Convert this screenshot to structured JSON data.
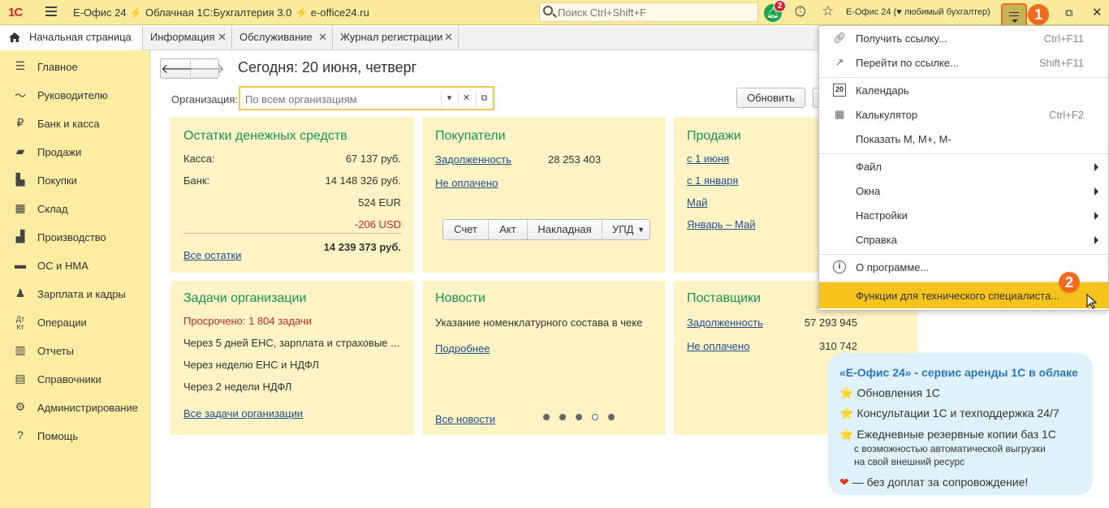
{
  "topbar": {
    "logo": "1С",
    "title": "Е-Офис 24 ⚡ Облачная 1С:Бухгалтерия 3.0 ⚡ e-office24.ru",
    "search_placeholder": "Поиск Ctrl+Shift+F",
    "notifications_count": "2",
    "user": "Е-Офис 24 (♥ любимый бухгалтер)"
  },
  "callouts": {
    "one": "1",
    "two": "2"
  },
  "tabs": [
    "Начальная страница",
    "Информация",
    "Обслуживание",
    "Журнал регистрации"
  ],
  "sidebar": [
    {
      "label": "Главное",
      "icon": "list-icon"
    },
    {
      "label": "Руководителю",
      "icon": "trend-icon"
    },
    {
      "label": "Банк и касса",
      "icon": "coin-icon"
    },
    {
      "label": "Продажи",
      "icon": "bag-icon"
    },
    {
      "label": "Покупки",
      "icon": "cart-icon"
    },
    {
      "label": "Склад",
      "icon": "grid-icon"
    },
    {
      "label": "Производство",
      "icon": "factory-icon"
    },
    {
      "label": "ОС и НМА",
      "icon": "truck-icon"
    },
    {
      "label": "Зарплата и кадры",
      "icon": "person-icon"
    },
    {
      "label": "Операции",
      "icon": "dt-kt-icon"
    },
    {
      "label": "Отчеты",
      "icon": "bars-icon"
    },
    {
      "label": "Справочники",
      "icon": "book-icon"
    },
    {
      "label": "Администрирование",
      "icon": "gear-icon"
    },
    {
      "label": "Помощь",
      "icon": "question-icon"
    }
  ],
  "main": {
    "today": "Сегодня: 20 июня, четверг",
    "org_label": "Организация:",
    "org_placeholder": "По всем организациям",
    "refresh": "Обновить"
  },
  "cash": {
    "title": "Остатки денежных средств",
    "kassa_label": "Касса:",
    "kassa_value": "67 137 руб.",
    "bank_label": "Банк:",
    "bank_value": "14 148 326 руб.",
    "eur": "524 EUR",
    "usd": "-206 USD",
    "total": "14 239 373 руб.",
    "link": "Все остатки"
  },
  "buyers": {
    "title": "Покупатели",
    "debt_link": "Задолженность",
    "debt_value": "28 253 403",
    "unpaid_link": "Не оплачено",
    "buttons": [
      "Счет",
      "Акт",
      "Накладная",
      "УПД"
    ]
  },
  "sales": {
    "title": "Продажи",
    "links": [
      "с 1 июня",
      "с 1 января",
      "Май",
      "Январь – Май"
    ]
  },
  "tasks": {
    "title": "Задачи организации",
    "overdue": "Просрочено: 1 804 задачи",
    "items": [
      "Через 5 дней ЕНС, зарплата и страховые ...",
      "Через неделю ЕНС и НДФЛ",
      "Через 2 недели НДФЛ"
    ],
    "link": "Все задачи организации"
  },
  "news": {
    "title": "Новости",
    "text": "Указание номенклатурного состава в чеке",
    "more": "Подробнее",
    "all": "Все новости"
  },
  "suppliers": {
    "title": "Поставщики",
    "debt_link": "Задолженность",
    "debt_value": "57 293 945",
    "unpaid_link": "Не оплачено",
    "unpaid_value": "310 742"
  },
  "menu": {
    "get_link": "Получить ссылку...",
    "get_link_sc": "Ctrl+F11",
    "go_link": "Перейти по ссылке...",
    "go_link_sc": "Shift+F11",
    "calendar": "Календарь",
    "calculator": "Калькулятор",
    "calculator_sc": "Ctrl+F2",
    "show_m": "Показать M, M+, M-",
    "file": "Файл",
    "windows": "Окна",
    "settings": "Настройки",
    "help": "Справка",
    "about": "О программе...",
    "tech": "Функции для технического специалиста..."
  },
  "promo": {
    "title": "«Е-Офис 24» - сервис аренды 1С в облаке",
    "items": [
      "Обновления 1С",
      "Консультации 1С и техподдержка 24/7",
      "Ежедневные резервные копии баз 1С"
    ],
    "sub1": "с возможностью автоматической выгрузки",
    "sub2": "на свой внешний ресурс",
    "last": "— без доплат за сопровождение!"
  }
}
